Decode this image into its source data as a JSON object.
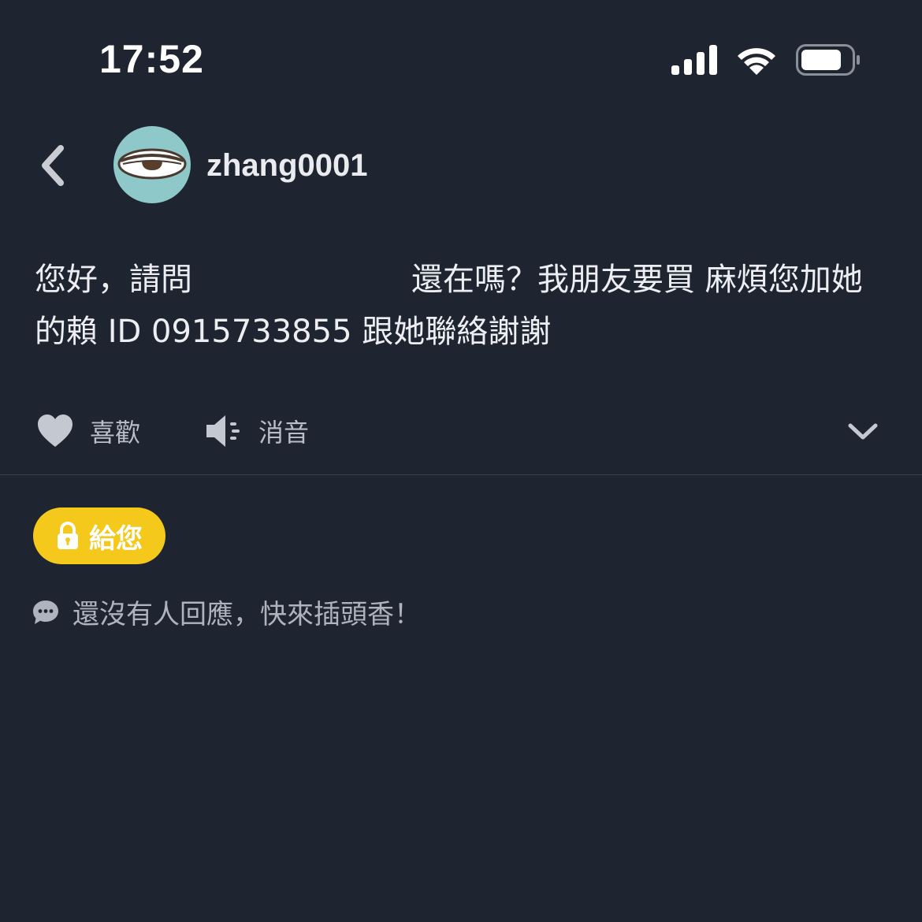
{
  "status_bar": {
    "time": "17:52",
    "icons": [
      "cellular-signal-icon",
      "wifi-icon",
      "battery-icon"
    ]
  },
  "header": {
    "back_icon": "chevron-left-icon",
    "avatar": "eye-avatar",
    "username": "zhang0001"
  },
  "post": {
    "text_part1": "您好，請問",
    "text_part2": "還在嗎？我朋友要買 麻煩您加她的賴 ID 0915733855 跟她聯絡謝謝"
  },
  "actions": {
    "like_label": "喜歡",
    "like_icon": "heart-icon",
    "mute_label": "消音",
    "mute_icon": "speaker-mute-icon",
    "expand_icon": "chevron-down-icon"
  },
  "give_button": {
    "label": "給您",
    "icon": "lock-icon",
    "color": "#f5c91c"
  },
  "replies": {
    "empty_text": "還沒有人回應，快來插頭香！",
    "icon": "comment-bubble-icon"
  },
  "colors": {
    "background": "#1f2431",
    "text": "#eceef2",
    "muted": "#b9bec8",
    "accent": "#f5c91c"
  }
}
